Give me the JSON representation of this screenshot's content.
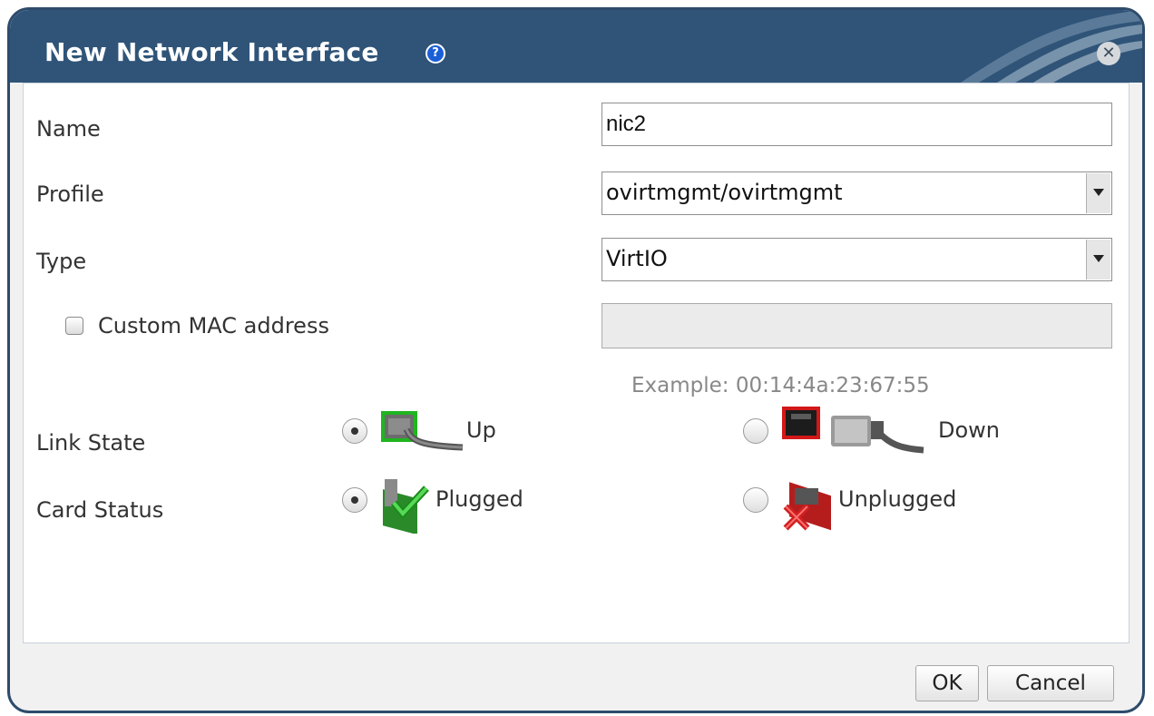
{
  "dialog": {
    "title": "New Network Interface",
    "help_glyph": "?",
    "close_glyph": "✕",
    "accent_color": "#2f5478"
  },
  "form": {
    "name_label": "Name",
    "name_value": "nic2",
    "profile_label": "Profile",
    "profile_value": "ovirtmgmt/ovirtmgmt",
    "type_label": "Type",
    "type_value": "VirtIO",
    "custom_mac_label": "Custom MAC address",
    "custom_mac_checked": false,
    "mac_value": "",
    "mac_example": "Example: 00:14:4a:23:67:55",
    "link_state_label": "Link State",
    "link_up_label": "Up",
    "link_down_label": "Down",
    "link_state_selected": "Up",
    "card_status_label": "Card Status",
    "plugged_label": "Plugged",
    "unplugged_label": "Unplugged",
    "card_status_selected": "Plugged"
  },
  "icons": {
    "link_up": "network-cable-plugged-icon",
    "link_down": "network-port-unplugged-icon",
    "plugged": "nic-card-plugged-icon",
    "unplugged": "nic-card-unplugged-icon"
  },
  "footer": {
    "ok_label": "OK",
    "cancel_label": "Cancel"
  }
}
